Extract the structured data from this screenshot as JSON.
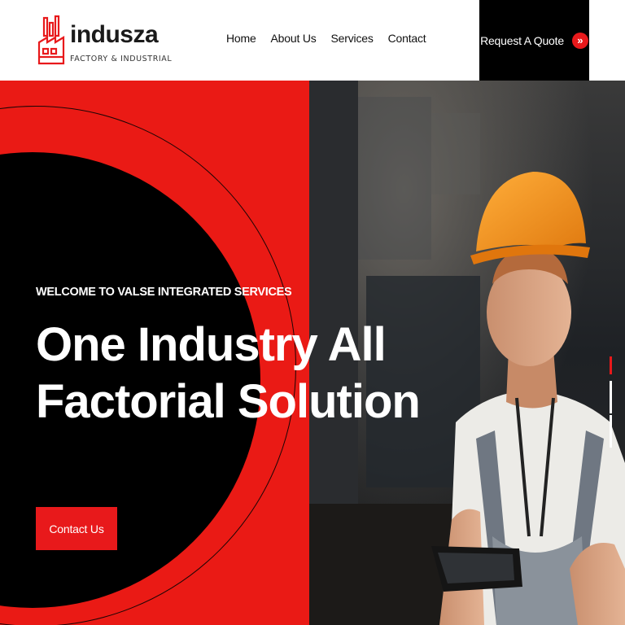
{
  "brand": {
    "name": "indusza",
    "tagline": "FACTORY & INDUSTRIAL",
    "logo_icon": "factory-icon",
    "accent_color": "#e8191b"
  },
  "nav": {
    "items": [
      {
        "label": "Home"
      },
      {
        "label": "About Us"
      },
      {
        "label": "Services"
      },
      {
        "label": "Contact"
      }
    ]
  },
  "header": {
    "cta_label": "Request A Quote",
    "cta_icon": "double-chevron-right-icon"
  },
  "hero": {
    "eyebrow": "WELCOME TO VALSE INTEGRATED SERVICES",
    "headline_line1": "One Industry All",
    "headline_line2": "Factorial Solution",
    "button_label": "Contact Us",
    "image": "worker-with-hard-hat-photo",
    "slider_count": 3,
    "slider_active": 1
  }
}
